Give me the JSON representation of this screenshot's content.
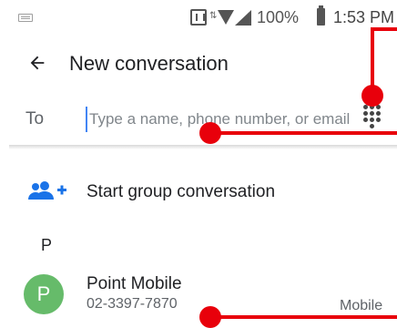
{
  "status_bar": {
    "battery_percent": "100%",
    "time": "1:53 PM",
    "icons": [
      "keyboard-icon",
      "nfc-icon",
      "data-arrows-icon",
      "wifi-icon",
      "signal-icon",
      "battery-icon"
    ]
  },
  "app_bar": {
    "back_icon": "arrow-back-icon",
    "title": "New conversation"
  },
  "recipient": {
    "label": "To",
    "placeholder": "Type a name, phone number, or email",
    "value": "",
    "dialpad_icon": "dialpad-icon"
  },
  "group_conversation": {
    "icon": "group-add-icon",
    "label": "Start group conversation"
  },
  "contacts": {
    "section_header": "P",
    "items": [
      {
        "avatar_letter": "P",
        "name": "Point Mobile",
        "number": "02-3397-7870",
        "type": "Mobile",
        "avatar_color": "#66bb6a"
      }
    ]
  },
  "annotation_color": "#e8000b"
}
